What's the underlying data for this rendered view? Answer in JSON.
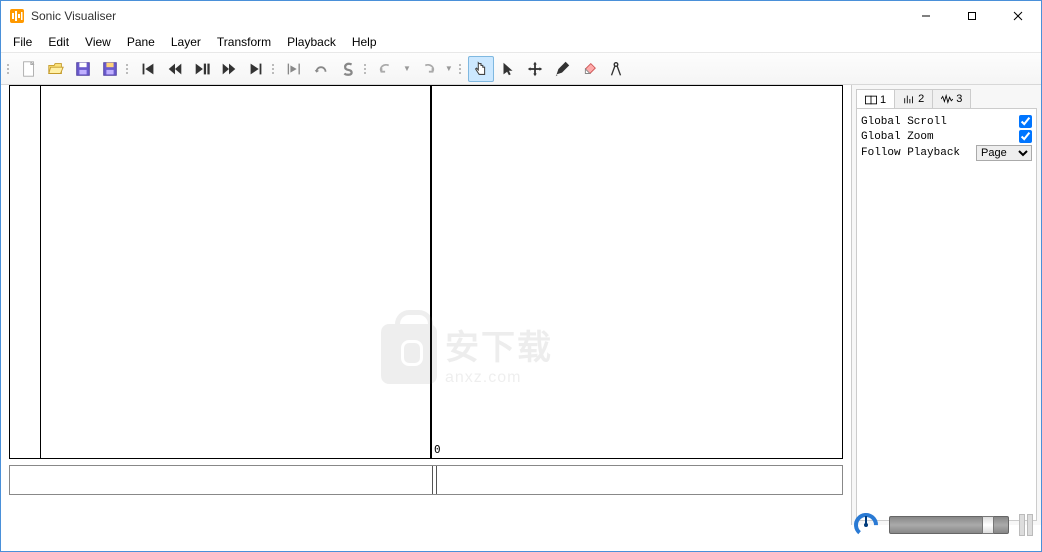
{
  "window": {
    "title": "Sonic Visualiser"
  },
  "menu": {
    "items": [
      "File",
      "Edit",
      "View",
      "Pane",
      "Layer",
      "Transform",
      "Playback",
      "Help"
    ]
  },
  "toolbar": {
    "new": "new-file",
    "open": "open-file",
    "save": "save",
    "save_as": "save-as",
    "skip_start": "skip-to-start",
    "rewind": "rewind",
    "play_pause": "play-pause",
    "fast_forward": "fast-forward",
    "skip_end": "skip-to-end",
    "play_selection": "play-selection",
    "loop": "loop",
    "solo": "solo",
    "undo": "undo",
    "redo": "redo",
    "navigate": "navigate-tool",
    "select": "select-tool",
    "move": "move-tool",
    "draw": "draw-tool",
    "erase": "erase-tool",
    "measure": "measure-tool"
  },
  "pane": {
    "zero_label": "0"
  },
  "sidepanel": {
    "tabs": [
      {
        "label": "1"
      },
      {
        "label": "2"
      },
      {
        "label": "3"
      }
    ],
    "global_scroll_label": "Global Scroll",
    "global_scroll_checked": true,
    "global_zoom_label": "Global Zoom",
    "global_zoom_checked": true,
    "follow_playback_label": "Follow Playback",
    "follow_playback_value": "Page"
  },
  "watermark": {
    "cn": "安下载",
    "en": "anxz.com"
  }
}
